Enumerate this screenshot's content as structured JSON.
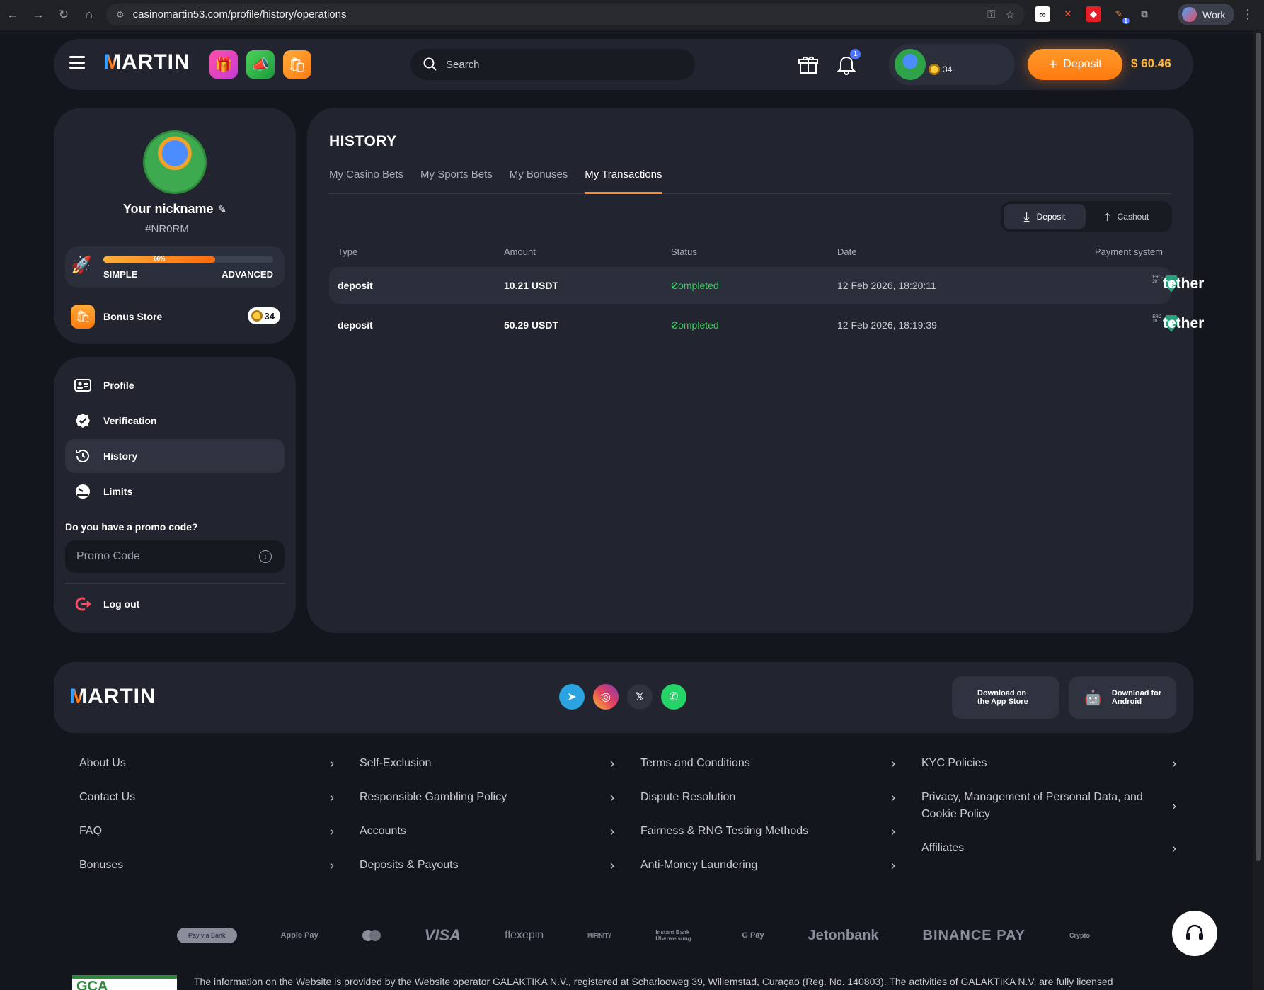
{
  "browser": {
    "url": "casinomartin53.com/profile/history/operations",
    "profile_label": "Work",
    "ext_badge": "1"
  },
  "header": {
    "logo": "MARTIN",
    "search_placeholder": "Search",
    "notification_count": "1",
    "coin_count": "34",
    "deposit_label": "Deposit",
    "balance": "$ 60.46"
  },
  "profile": {
    "nickname": "Your nickname",
    "user_id": "#NR0RM",
    "level_progress": "66%",
    "level_from": "SIMPLE",
    "level_to": "ADVANCED",
    "bonus_store_label": "Bonus Store",
    "bonus_store_count": "34"
  },
  "menu": {
    "items": [
      {
        "label": "Profile",
        "icon": "id-card-icon"
      },
      {
        "label": "Verification",
        "icon": "verified-badge-icon"
      },
      {
        "label": "History",
        "icon": "history-clock-icon"
      },
      {
        "label": "Limits",
        "icon": "gauge-icon"
      }
    ],
    "promo_question": "Do you have a promo code?",
    "promo_placeholder": "Promo Code",
    "logout_label": "Log out"
  },
  "history": {
    "title": "HISTORY",
    "tabs": [
      "My Casino Bets",
      "My Sports Bets",
      "My Bonuses",
      "My Transactions"
    ],
    "active_tab": "My Transactions",
    "toggle": {
      "deposit": "Deposit",
      "cashout": "Cashout",
      "active": "Deposit"
    },
    "columns": [
      "Type",
      "Amount",
      "Status",
      "Date",
      "Payment system"
    ],
    "rows": [
      {
        "type": "deposit",
        "amount": "10.21 USDT",
        "status": "Completed",
        "date": "12 Feb 2026, 18:20:11",
        "payment": "tether",
        "payment_sub": "ERC-20"
      },
      {
        "type": "deposit",
        "amount": "50.29 USDT",
        "status": "Completed",
        "date": "12 Feb 2026, 18:19:39",
        "payment": "tether",
        "payment_sub": "ERC-20"
      }
    ]
  },
  "footer": {
    "logo": "MARTIN",
    "socials": [
      "telegram-icon",
      "instagram-icon",
      "x-icon",
      "whatsapp-icon"
    ],
    "app_store": "Download on the App Store",
    "android": "Download for Android",
    "links": [
      [
        "About Us",
        "Contact Us",
        "FAQ",
        "Bonuses"
      ],
      [
        "Self-Exclusion",
        "Responsible Gambling Policy",
        "Accounts",
        "Deposits & Payouts"
      ],
      [
        "Terms and Conditions",
        "Dispute Resolution",
        "Fairness & RNG Testing Methods",
        "Anti-Money Laundering"
      ],
      [
        "KYC Policies",
        "Privacy, Management of Personal Data, and Cookie Policy",
        "Affiliates"
      ]
    ],
    "payments": [
      "Pay via Bank",
      "Apple Pay",
      "Mastercard",
      "VISA",
      "flexepin",
      "MIFINITY",
      "Instant Bank Überweisung",
      "G Pay",
      "Jetonbank",
      "BINANCE PAY",
      "Crypto"
    ],
    "legal": "The information on the Website is provided by the Website operator GALAKTIKA N.V., registered at Scharlooweg 39, Willemstad, Curaçao (Reg. No. 140803). The activities of GALAKTIKA N.V. are fully licensed",
    "license_badge": "GCA"
  },
  "colors": {
    "accent": "#ff8a1f",
    "success": "#2fd05a",
    "panel": "#22252f",
    "background": "#14161d",
    "tether": "#26a17b"
  }
}
